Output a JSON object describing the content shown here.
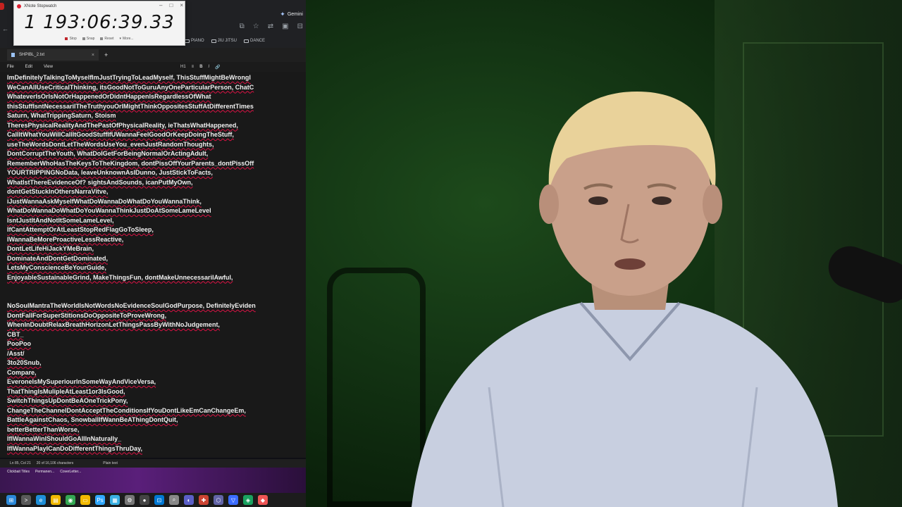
{
  "stopwatch": {
    "window_title": "XNote Stopwatch",
    "time": "1 193:06:39.33",
    "buttons": [
      "Stop",
      "Snap",
      "Reset",
      "More..."
    ],
    "controls": [
      "–",
      "□",
      "×"
    ]
  },
  "browser": {
    "tab_label": "Gemini",
    "bookmarks": [
      "PIANO",
      "JIU JITSU",
      "DANCE"
    ]
  },
  "notepad": {
    "tab_title": "SHPIBL_2.txt",
    "menu": [
      "File",
      "Edit",
      "View"
    ],
    "format_bar": [
      "H1",
      "≡",
      "B",
      "I",
      "🔗"
    ],
    "lines": [
      "ImDefinitelyTalkingToMyselfImJustTryingToLeadMyself, ThisStuffMightBeWrongI",
      "WeCanAllUseCriticalThinking, itsGoodNotToGuruAnyOneParticularPerson,  ChatC",
      "WhateverIsOrIsNotOrHappenedOrDidntHappenIsRegardlessOfWhat",
      "thisStuffIsntNecessarilTheTruthyouOrIMightThinkOppositesStuffAtDifferentTimes",
      "Saturn, WhatTrippingSaturn, Stoism",
      "TheresPhysicalRealityAndThePastOfPhysicalReality, ieThatsWhatHappened,",
      "CallItWhatYouWillCallItGoodStuffIfUWannaFeelGoodOrKeepDoingTheStuff,",
      "useTheWordsDontLetTheWordsUseYou_evenJustRandomThoughts,",
      "DontCorruptTheYouth, WhatDoIGetForBeingNormalOrActingAdult,",
      "RememberWhoHasTheKeysToTheKingdom, dontPissOffYourParents_dontPissOff",
      "YOURTRIPPINGNoData, leaveUnknownAsIDunno, JustStickToFacts,",
      "WhatIstThereEvidenceOf? sightsAndSounds, icanPutMyOwn,",
      "dontGetStuckInOthersNarraVitve,",
      "iJustWannaAskMyselfWhatDoWannaDoWhatDoYouWannaThink,",
      "WhatDoWannaDoWhatDoYouWannaThinkJustDoAtSomeLameLevel",
      "IsntJustItAndNotItSomeLameLevel,",
      "IfCantAttemptOrAtLeastStopRedFlagGoToSleep,",
      "IWannaBeMoreProactiveLessReactive,",
      "DontLetLifeHiJackYMeBrain,",
      "DominateAndDontGetDominated,",
      "LetsMyConscienceBeYourGuide,",
      "EnjoyableSustainableGrind, MakeThingsFun, dontMakeUnnecessarilAwful,",
      "",
      "",
      "NoSoulMantraTheWorldIsNotWordsNoEvidenceSoulGodPurpose, DefinitelyEviden",
      "DontFallForSuperStitionsDoOppositeToProveWrong,",
      "WhenInDoubtRelaxBreathHorizonLetThingsPassByWithNoJudgement,",
      "CBT_",
      "PooPoo",
      "/Asst/",
      "3to20Snub,",
      "Compare,",
      "EveroneIsMySuperiourInSomeWayAndViceVersa,",
      "ThatThingIsMulipleAtLeast1or3IsGood,",
      "SwitchThingsUpDontBeAOneTrickPony,",
      "ChangeTheChannelDontAcceptTheConditionsIfYouDontLikeEmCanChangeEm,",
      "BattleAgainstChaos, SnowballIfWannBeAThingDontQuit,",
      "betterBetterThanWorse,",
      "IfIWannaWinIShouldGoAllInNaturally_",
      "IfIWannaPlayICanDoDifferentThingsThruDay,"
    ],
    "status": {
      "position": "Ln 85, Col 21",
      "characters": "20 of 16,106 characters",
      "format": "Plain text"
    }
  },
  "desktop": {
    "items": [
      "Clickbait Titles",
      "Permanen...",
      "CoverLetter..."
    ]
  },
  "taskbar": {
    "icons": [
      "windows-start",
      "terminal",
      "edge",
      "files",
      "chrome",
      "folder",
      "photoshop",
      "notepad",
      "settings",
      "obs",
      "store",
      "search",
      "app",
      "app2",
      "app3",
      "vpn",
      "app4",
      "app5"
    ]
  },
  "colors": {
    "editor_bg": "#191919",
    "spell_underline": "#dd1144",
    "green_screen": "#143614"
  }
}
